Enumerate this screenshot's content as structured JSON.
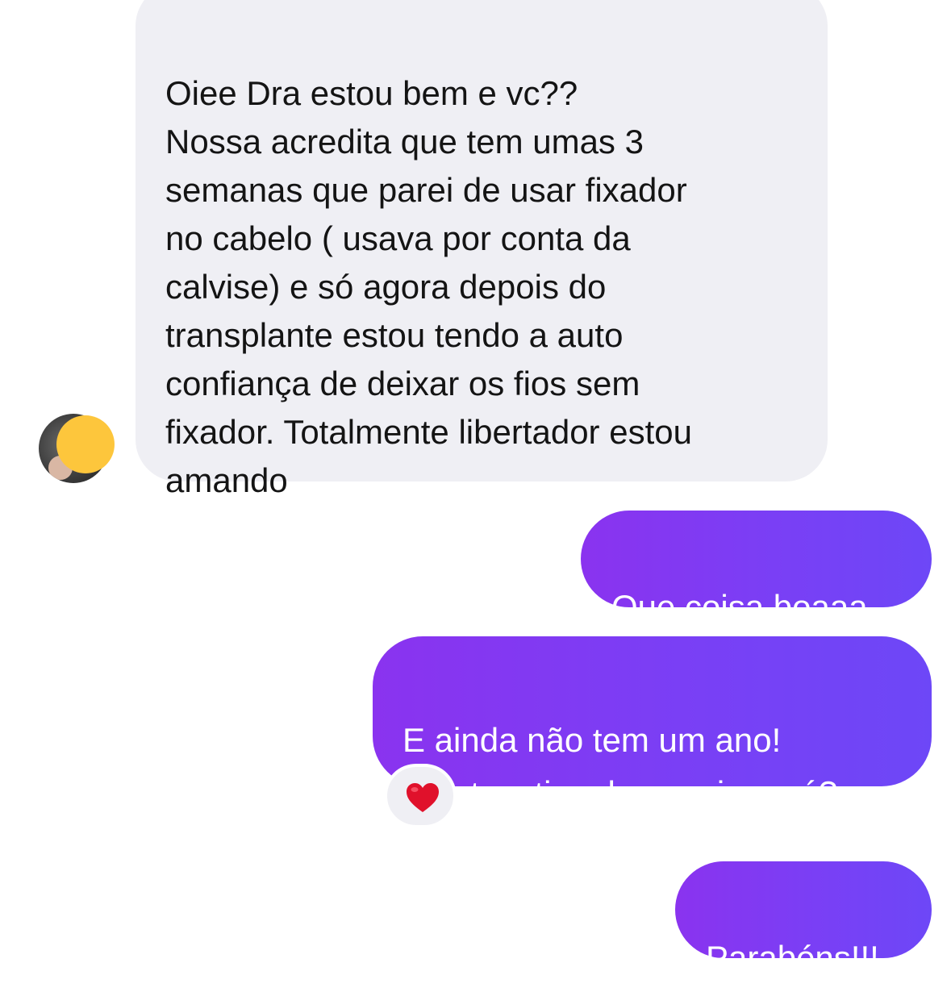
{
  "messages": {
    "incoming_1": "Oiee Dra estou bem e vc??\nNossa acredita que tem umas 3\nsemanas que parei de usar fixador\nno cabelo ( usava por conta da\ncalvise) e só agora depois do\ntransplante estou tendo a auto\nconfiança de deixar os fios sem\nfixador. Totalmente libertador estou\namando",
    "outgoing_1": "Que coisa boaaa",
    "outgoing_2": "E ainda não tem um ano!\nA autoestima la em cima né?",
    "outgoing_3": "Parabéns!!!"
  },
  "reaction": {
    "icon": "heart-icon",
    "color": "#e0112b"
  },
  "colors": {
    "incoming_bubble": "#efeff4",
    "outgoing_gradient_start": "#8a33ef",
    "outgoing_gradient_end": "#6d47f7",
    "avatar_cover": "#fdc63c"
  }
}
